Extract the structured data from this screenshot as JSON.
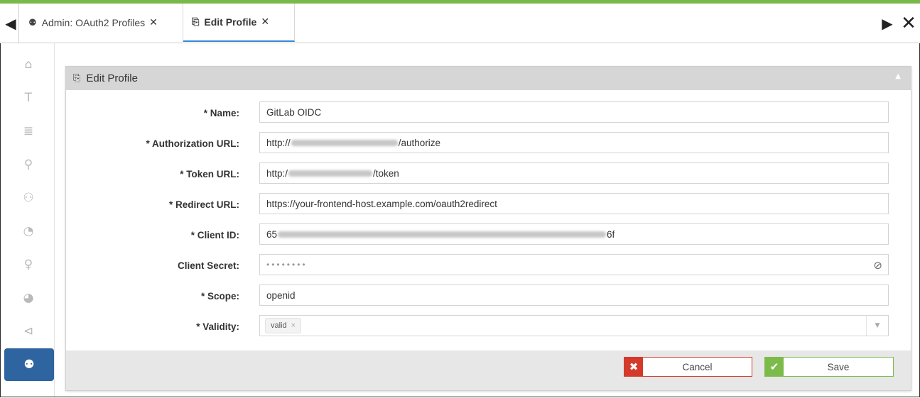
{
  "tabs": [
    {
      "icon": "admin-users-icon",
      "label": "Admin: OAuth2 Profiles",
      "close": "✕"
    },
    {
      "icon": "edit-profile-icon",
      "label": "Edit Profile",
      "close": "✕"
    }
  ],
  "tabstrip": {
    "scroll_left": "◀",
    "scroll_right": "▶",
    "close_all": "✕"
  },
  "sidebar": {
    "items": [
      {
        "name": "home-icon",
        "glyph": "⌂"
      },
      {
        "name": "text-icon",
        "glyph": "T"
      },
      {
        "name": "database-icon",
        "glyph": "≣"
      },
      {
        "name": "location-pin-icon",
        "glyph": "⚲"
      },
      {
        "name": "people-icon",
        "glyph": "⚇"
      },
      {
        "name": "gauge-icon",
        "glyph": "◔"
      },
      {
        "name": "lightbulb-icon",
        "glyph": "♀"
      },
      {
        "name": "pie-chart-icon",
        "glyph": "◕"
      },
      {
        "name": "megaphone-icon",
        "glyph": "⊲"
      },
      {
        "name": "admin-users-icon",
        "glyph": "⚉"
      }
    ]
  },
  "panel": {
    "title": "Edit Profile",
    "title_icon": "⎘",
    "collapse_icon": "▲"
  },
  "form": {
    "name": {
      "label": "* Name:",
      "value": "GitLab OIDC"
    },
    "authorization_url": {
      "label": "* Authorization URL:",
      "prefix": "http://",
      "suffix": "/authorize"
    },
    "token_url": {
      "label": "* Token URL:",
      "prefix": "http:/",
      "suffix": "/token"
    },
    "redirect_url": {
      "label": "* Redirect URL:",
      "value": "https://your-frontend-host.example.com/oauth2redirect"
    },
    "client_id": {
      "label": "* Client ID:",
      "prefix": "65",
      "suffix": "6f"
    },
    "client_secret": {
      "label": "Client Secret:",
      "value": "••••••••",
      "toggle_icon": "⊘"
    },
    "scope": {
      "label": "* Scope:",
      "value": "openid"
    },
    "validity": {
      "label": "* Validity:",
      "chip": "valid",
      "chip_remove": "×",
      "dropdown_icon": "▼"
    }
  },
  "footer": {
    "cancel_label": "Cancel",
    "cancel_icon": "✖",
    "save_label": "Save",
    "save_icon": "✔"
  },
  "colors": {
    "top_bar": "#78b94a",
    "active_tab_underline": "#3b86d7",
    "sidebar_active": "#2e64a0",
    "cancel": "#d33a2c",
    "save": "#7cbb4a"
  }
}
